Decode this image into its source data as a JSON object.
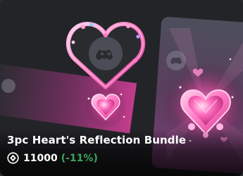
{
  "product": {
    "title": "3pc Heart's Reflection Bundle",
    "price": "11000",
    "discount": "(-11%)",
    "currency_icon": "orb-icon"
  },
  "colors": {
    "card_bg": "#232428",
    "accent_pink": "#ff5fb3",
    "discount_green": "#3ba55c",
    "text": "#ffffff"
  }
}
